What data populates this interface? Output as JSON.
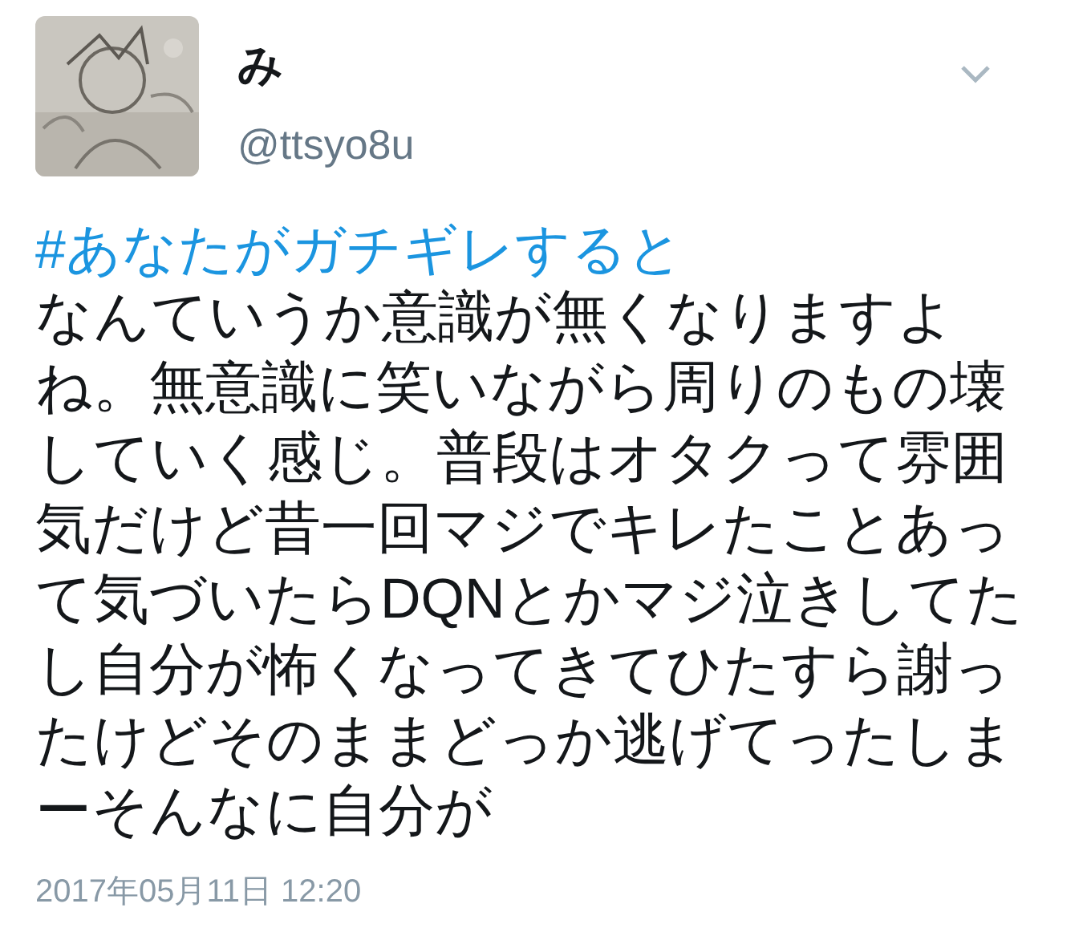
{
  "tweet": {
    "name": "み",
    "handle": "@ttsyo8u",
    "hashtag": "#あなたがガチギレすると",
    "body": "なんていうか意識が無くなりますよね。無意識に笑いながら周りのもの壊していく感じ。普段はオタクって雰囲気だけど昔一回マジでキレたことあって気づいたらDQNとかマジ泣きしてたし自分が怖くなってきてひたすら謝ったけどそのままどっか逃げてったしまーそんなに自分が",
    "timestamp": "2017年05月11日 12:20"
  }
}
